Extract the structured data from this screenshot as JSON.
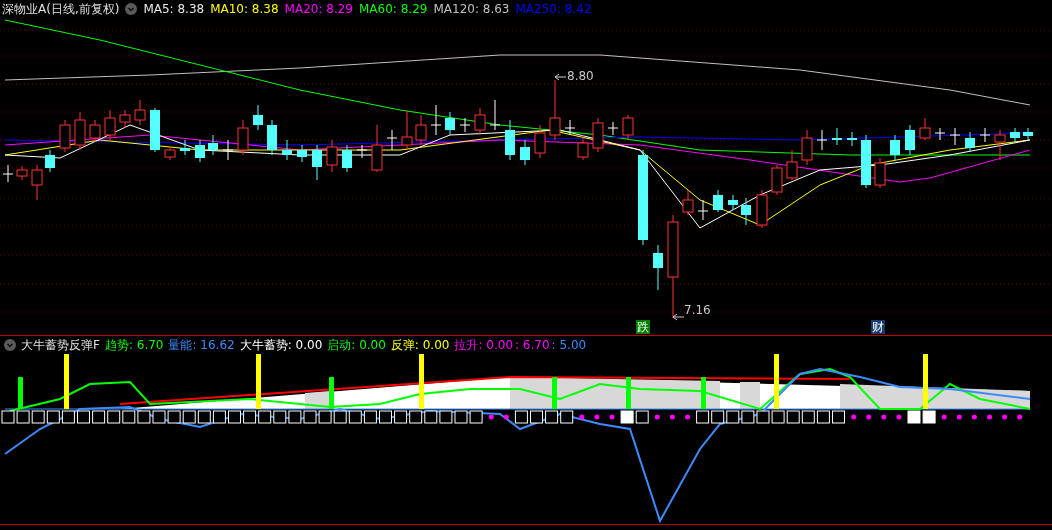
{
  "main_panel": {
    "title": "深物业A(日线,前复权)",
    "indicators": [
      {
        "label": "MA5: 8.38",
        "color": "#e8e8e8"
      },
      {
        "label": "MA10: 8.38",
        "color": "#ffff00"
      },
      {
        "label": "MA20: 8.29",
        "color": "#ff00ff"
      },
      {
        "label": "MA60: 8.29",
        "color": "#00ff00"
      },
      {
        "label": "MA120: 8.63",
        "color": "#c0c0c0"
      },
      {
        "label": "MA250: 8.42",
        "color": "#0000ff"
      }
    ],
    "price_labels": [
      {
        "kind": "high",
        "text": "8.80"
      },
      {
        "kind": "low",
        "text": "7.16"
      }
    ],
    "markers": [
      {
        "text": "跌",
        "color": "#008000"
      },
      {
        "text": "财",
        "color": "#163c6e"
      }
    ]
  },
  "sub_panel": {
    "title": "大牛蓄势反弹F",
    "indicators": [
      {
        "label": "趋势: 6.70",
        "color": "#00ff00"
      },
      {
        "label": "量能: 16.62",
        "color": "#3c8cff"
      },
      {
        "label": "大牛蓄势: 0.00",
        "color": "#ffffff"
      },
      {
        "label": "启动: 0.00",
        "color": "#00ff00"
      },
      {
        "label": "反弹: 0.00",
        "color": "#ffff00"
      },
      {
        "label": "拉升: 0.00",
        "color": "#ff00ff"
      },
      {
        "label": ": 6.70",
        "color": "#ff00ff"
      },
      {
        "label": ": 5.00",
        "color": "#3c8cff"
      }
    ]
  }
}
